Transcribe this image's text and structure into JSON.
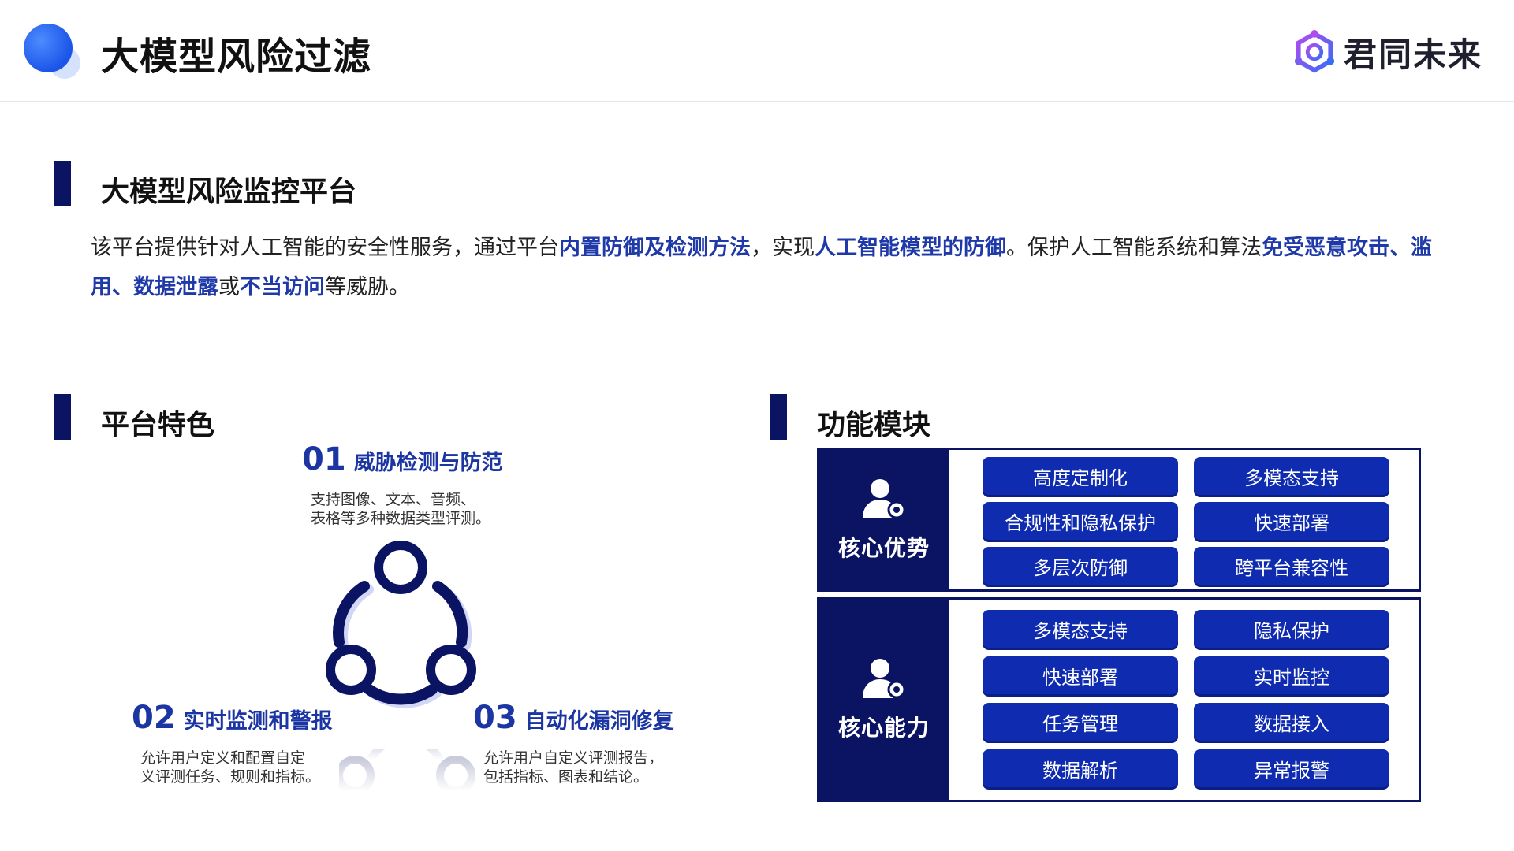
{
  "header": {
    "title": "大模型风险过滤",
    "brand": "君同未来"
  },
  "section_main": {
    "title": "大模型风险监控平台",
    "desc_parts": [
      {
        "text": "该平台提供针对人工智能的安全性服务，通过平台",
        "hl": false
      },
      {
        "text": "内置防御及检测方法",
        "hl": true
      },
      {
        "text": "，实现",
        "hl": false
      },
      {
        "text": "人工智能模型的防御",
        "hl": true
      },
      {
        "text": "。保护人工智能系统和算法",
        "hl": false
      },
      {
        "text": "免受恶意攻击、滥用、数据泄露",
        "hl": true
      },
      {
        "text": "或",
        "hl": false
      },
      {
        "text": "不当访问",
        "hl": true
      },
      {
        "text": "等威胁。",
        "hl": false
      }
    ]
  },
  "features": {
    "title": "平台特色",
    "items": [
      {
        "num": "01",
        "title": "威胁检测与防范",
        "desc_line1": "支持图像、文本、音频、",
        "desc_line2": "表格等多种数据类型评测。"
      },
      {
        "num": "02",
        "title": "实时监测和警报",
        "desc_line1": "允许用户定义和配置自定",
        "desc_line2": "义评测任务、规则和指标。"
      },
      {
        "num": "03",
        "title": "自动化漏洞修复",
        "desc_line1": "允许用户自定义评测报告，",
        "desc_line2": "包括指标、图表和结论。"
      }
    ]
  },
  "modules": {
    "title": "功能模块",
    "core_advantages": {
      "label": "核心优势",
      "items": [
        "高度定制化",
        "多模态支持",
        "合规性和隐私保护",
        "快速部署",
        "多层次防御",
        "跨平台兼容性"
      ]
    },
    "core_capabilities": {
      "label": "核心能力",
      "items": [
        "多模态支持",
        "隐私保护",
        "快速部署",
        "实时监控",
        "任务管理",
        "数据接入",
        "数据解析",
        "异常报警"
      ]
    }
  },
  "colors": {
    "navy": "#0b1463",
    "pill": "#0f2bb0",
    "accent_text": "#1b35a3",
    "logo_dot": "#1a55e8"
  }
}
